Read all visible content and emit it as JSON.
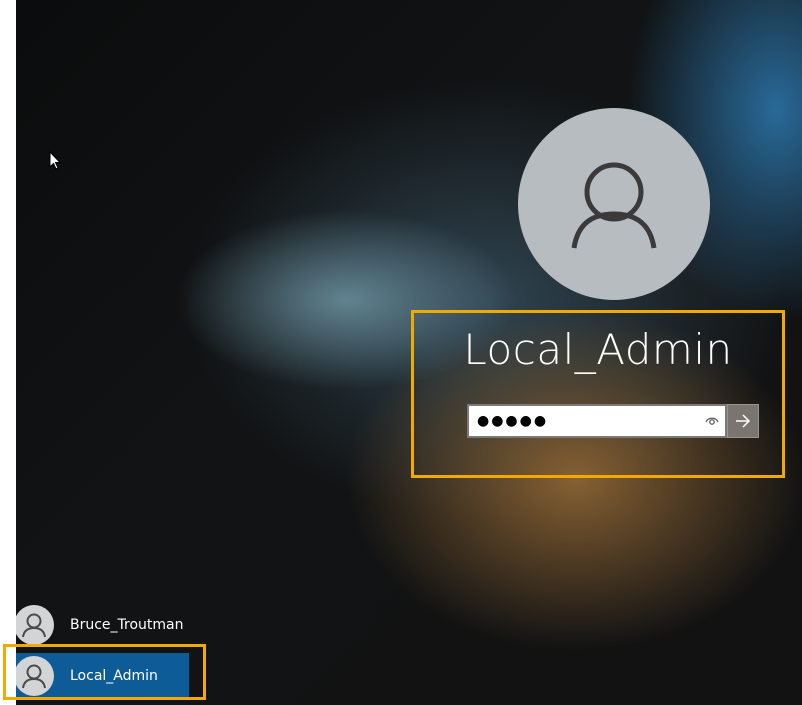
{
  "login": {
    "username": "Local_Admin",
    "password_mask": "●●●●●",
    "reveal_icon": "eye-icon",
    "submit_icon": "arrow-right-icon",
    "avatar_icon": "user-icon"
  },
  "user_list": [
    {
      "name": "Bruce_Troutman",
      "selected": false
    },
    {
      "name": "Local_Admin",
      "selected": true
    }
  ],
  "colors": {
    "highlight": "#f2a900",
    "selected_user_bg": "#0e5c97",
    "avatar_bg": "#b7bcc0",
    "submit_bg": "#7b756f"
  }
}
